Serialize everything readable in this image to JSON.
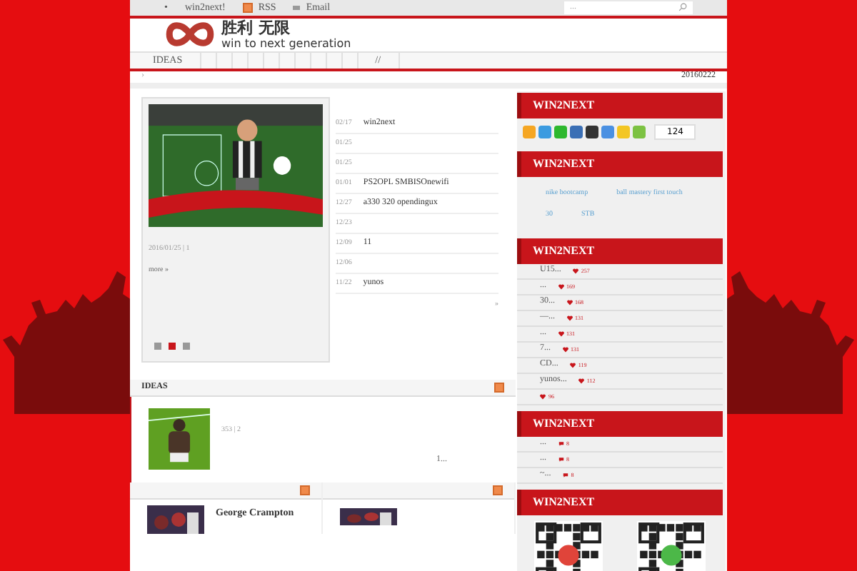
{
  "topbar": {
    "bullet": "•",
    "links": [
      {
        "kind": "plain",
        "label": "win2next!"
      },
      {
        "kind": "rss",
        "label": "RSS"
      },
      {
        "kind": "email",
        "label": "Email"
      }
    ],
    "search": {
      "placeholder": "..."
    }
  },
  "logo": {
    "title": "胜利 无限",
    "tagline": "win to next generation"
  },
  "nav": {
    "items": [
      {
        "kind": "link",
        "label": "IDEAS"
      },
      {
        "kind": "blank"
      },
      {
        "kind": "blank"
      },
      {
        "kind": "blank"
      },
      {
        "kind": "blank"
      },
      {
        "kind": "blank"
      },
      {
        "kind": "blank"
      },
      {
        "kind": "blank"
      },
      {
        "kind": "blank"
      },
      {
        "kind": "blank"
      },
      {
        "kind": "blank"
      },
      {
        "kind": "link",
        "label": "//"
      }
    ]
  },
  "breadcrumb": {
    "left": "›",
    "date": "20160222"
  },
  "featured": {
    "meta": "2016/01/25 | 1",
    "more": "more »",
    "dots": [
      {
        "selected": false
      },
      {
        "selected": true
      },
      {
        "selected": false
      }
    ]
  },
  "recent": {
    "items": [
      {
        "date": "02/17",
        "title": "win2next"
      },
      {
        "date": "01/25"
      },
      {
        "date": "01/25"
      },
      {
        "date": "01/01",
        "title": "PS2OPL SMBISOnewifi"
      },
      {
        "date": "12/27",
        "title": "a330 320 opendingux"
      },
      {
        "date": "12/23"
      },
      {
        "date": "12/09",
        "title": "11"
      },
      {
        "date": "12/06"
      },
      {
        "date": "11/22",
        "title": "yunos"
      }
    ],
    "more": "»"
  },
  "share": {
    "title": "WIN2NEXT",
    "count": "124"
  },
  "tags": {
    "title": "WIN2NEXT",
    "items": [
      "nike bootcamp",
      "ball mastery first touch",
      "30",
      "STB"
    ]
  },
  "hot": {
    "title": "WIN2NEXT",
    "items": [
      {
        "title": "U15...",
        "count": "257"
      },
      {
        "title": "...",
        "count": "169"
      },
      {
        "title": "30...",
        "count": "168"
      },
      {
        "title": "—...",
        "count": "131"
      },
      {
        "title": "...",
        "count": "131"
      },
      {
        "title": "7...",
        "count": "131"
      },
      {
        "title": "CD...",
        "count": "119"
      },
      {
        "title": "yunos...",
        "count": "112"
      },
      {
        "count": "96"
      }
    ]
  },
  "comments": {
    "title": "WIN2NEXT",
    "items": [
      {
        "title": "...",
        "count": "8"
      },
      {
        "title": "...",
        "count": "8"
      },
      {
        "title": "~...",
        "count": "8"
      }
    ]
  },
  "qr": {
    "title": "WIN2NEXT"
  },
  "ideas": {
    "title": "IDEAS",
    "meta": "353 | 2",
    "excerpt": "1..."
  },
  "columns": [
    {
      "title": "George Crampton"
    },
    {}
  ]
}
